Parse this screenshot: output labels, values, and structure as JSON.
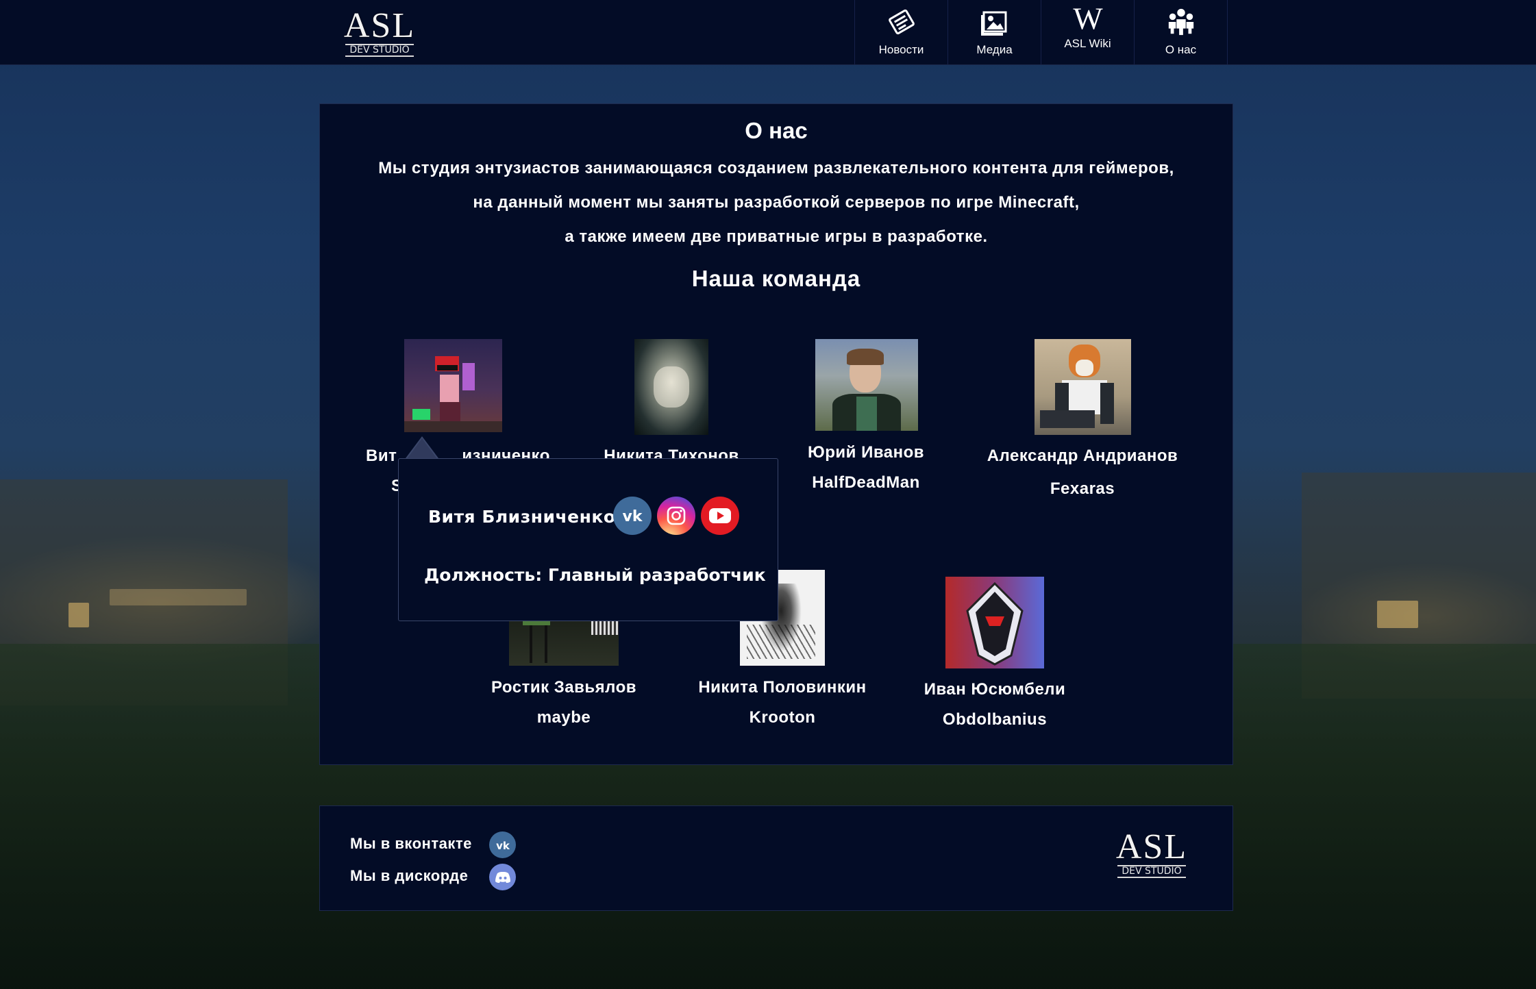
{
  "header": {
    "logo": {
      "main": "ASL",
      "sub": "DEV STUDIO"
    },
    "nav": [
      {
        "label": "Новости",
        "icon": "news-icon"
      },
      {
        "label": "Медиа",
        "icon": "image-icon"
      },
      {
        "label": "ASL Wiki",
        "icon": "wiki-icon"
      },
      {
        "label": "О нас",
        "icon": "team-icon"
      }
    ]
  },
  "about": {
    "title": "О нас",
    "lines": [
      "Мы студия энтузиастов занимающаяся созданием развлекательного контента для геймеров,",
      "на данный момент мы заняты разработкой серверов по игре Minecraft,",
      "а также имеем две  приватные игры в разработке."
    ],
    "team_title": "Наша команда"
  },
  "team": [
    {
      "name": "Витя Близниченко",
      "nick": "S",
      "visible_name": "Вит",
      "visible_name_tail": "изниченко"
    },
    {
      "name": "Никита Тихонов",
      "nick": ""
    },
    {
      "name": "Юрий Иванов",
      "nick": "HalfDeadMan"
    },
    {
      "name": "Александр Андрианов",
      "nick": "Fexaras"
    },
    {
      "name": "Ростик Завьялов",
      "nick": "maybe"
    },
    {
      "name": "Никита Половинкин",
      "nick": "Krooton"
    },
    {
      "name": "Иван Юсюмбели",
      "nick": "Obdolbanius"
    }
  ],
  "tooltip": {
    "name": "Витя Близниченко",
    "role": "Должность: Главный разработчик",
    "socials": [
      "vk-icon",
      "instagram-icon",
      "youtube-icon"
    ]
  },
  "footer": {
    "vk_text": "Мы в вконтакте",
    "discord_text": "Мы в дискорде",
    "logo": {
      "main": "ASL",
      "sub": "DEV STUDIO"
    }
  },
  "colors": {
    "panel": "#030c26",
    "vk": "#3f6b9a",
    "youtube": "#e31b23",
    "discord": "#7289da"
  }
}
